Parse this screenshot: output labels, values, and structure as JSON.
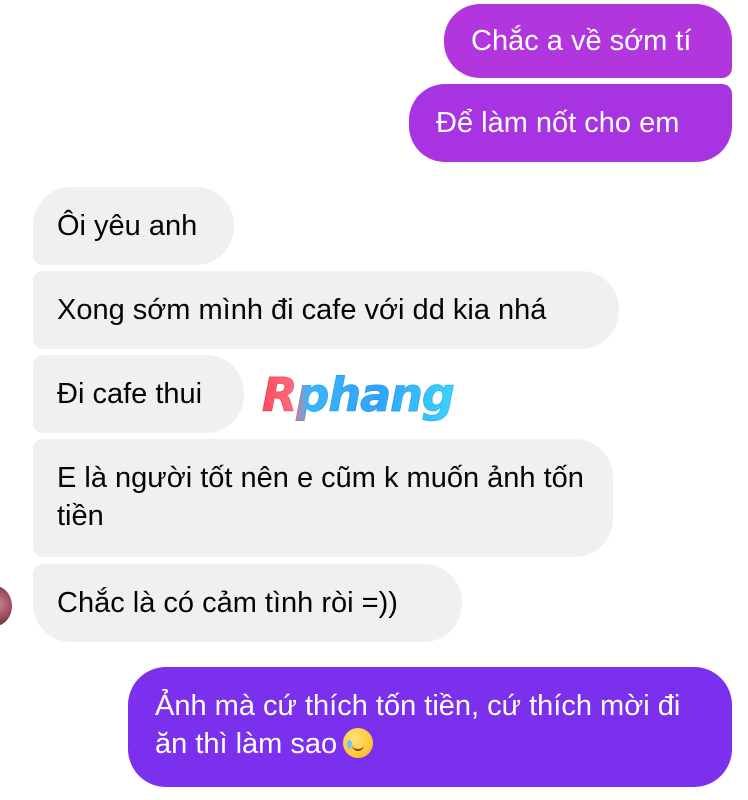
{
  "conversation": {
    "messages": [
      {
        "sender": "me",
        "text": "Chắc a về sớm tí"
      },
      {
        "sender": "me",
        "text": "Để làm nốt cho em"
      },
      {
        "sender": "them",
        "text": "Ôi yêu anh"
      },
      {
        "sender": "them",
        "text": "Xong sớm mình đi cafe với dd kia nhá"
      },
      {
        "sender": "them",
        "text": "Đi cafe thui"
      },
      {
        "sender": "them",
        "text": "E là người tốt nên e cũm k muốn ảnh tốn tiền"
      },
      {
        "sender": "them",
        "text": "Chắc là có cảm tình ròi =))"
      },
      {
        "sender": "me",
        "text": "Ảnh mà cứ thích tốn tiền, cứ thích mời đi ăn thì làm sao",
        "emoji": "crying-smile-emoji"
      }
    ]
  },
  "watermark": {
    "text": "Rphang"
  },
  "colors": {
    "sent_top": "#a030e0",
    "sent_bottom": "#7b30ee",
    "received_bg": "#f0f0f2",
    "received_text": "#050505",
    "sent_text": "#ffffff"
  }
}
